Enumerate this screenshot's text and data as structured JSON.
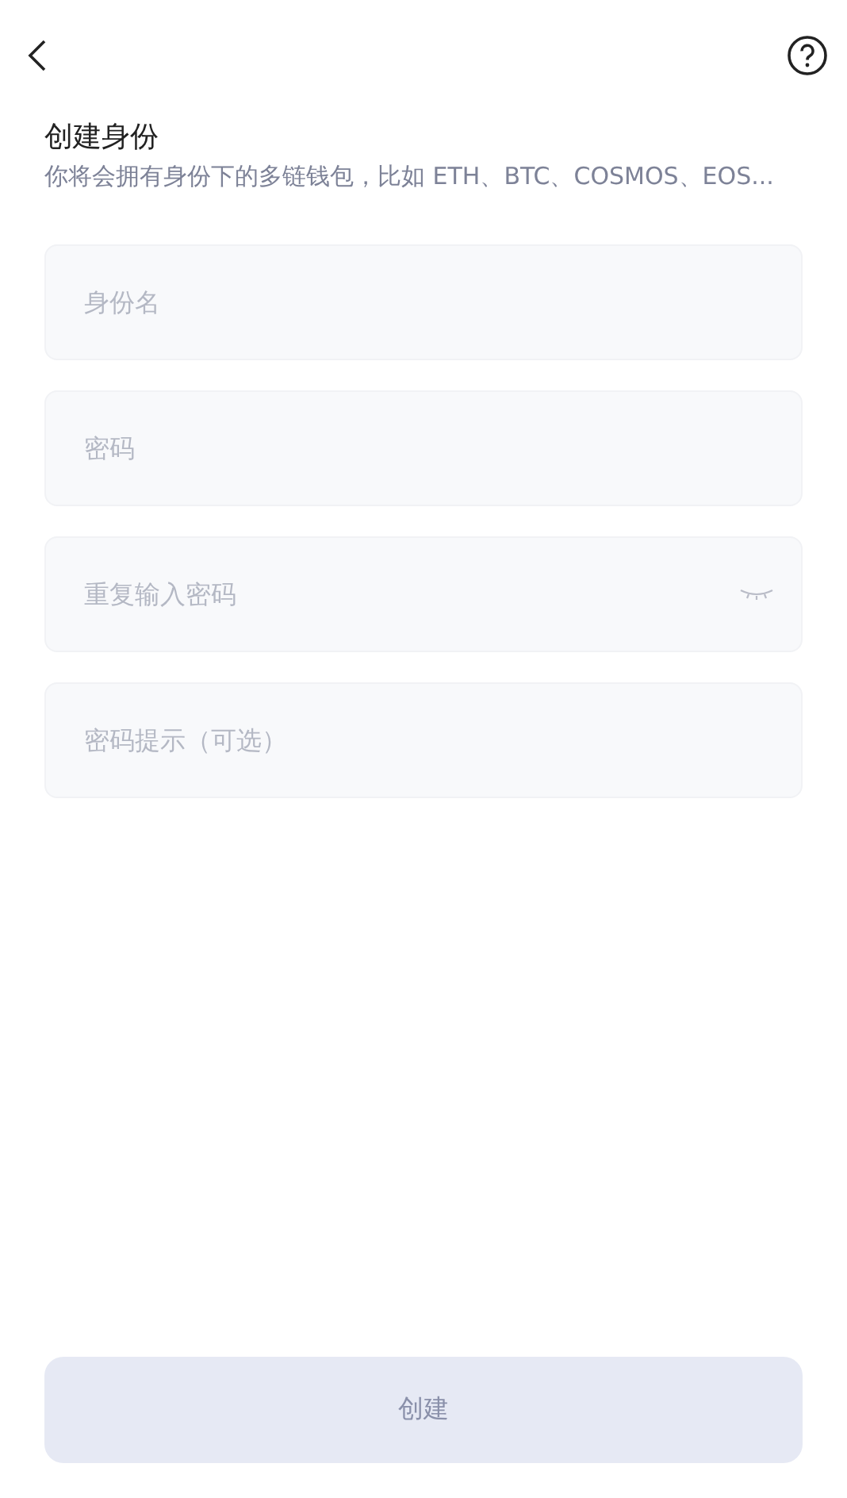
{
  "header": {
    "title": "创建身份",
    "subtitle": "你将会拥有身份下的多链钱包，比如 ETH、BTC、COSMOS、EOS..."
  },
  "fields": [
    {
      "kind": "text",
      "placeholder": "身份名"
    },
    {
      "kind": "text",
      "placeholder": "密码"
    },
    {
      "kind": "toggle",
      "placeholder": "重复输入密码"
    },
    {
      "kind": "text",
      "placeholder": "密码提示（可选）"
    }
  ],
  "submit": {
    "label": "创建",
    "disabled": true
  }
}
